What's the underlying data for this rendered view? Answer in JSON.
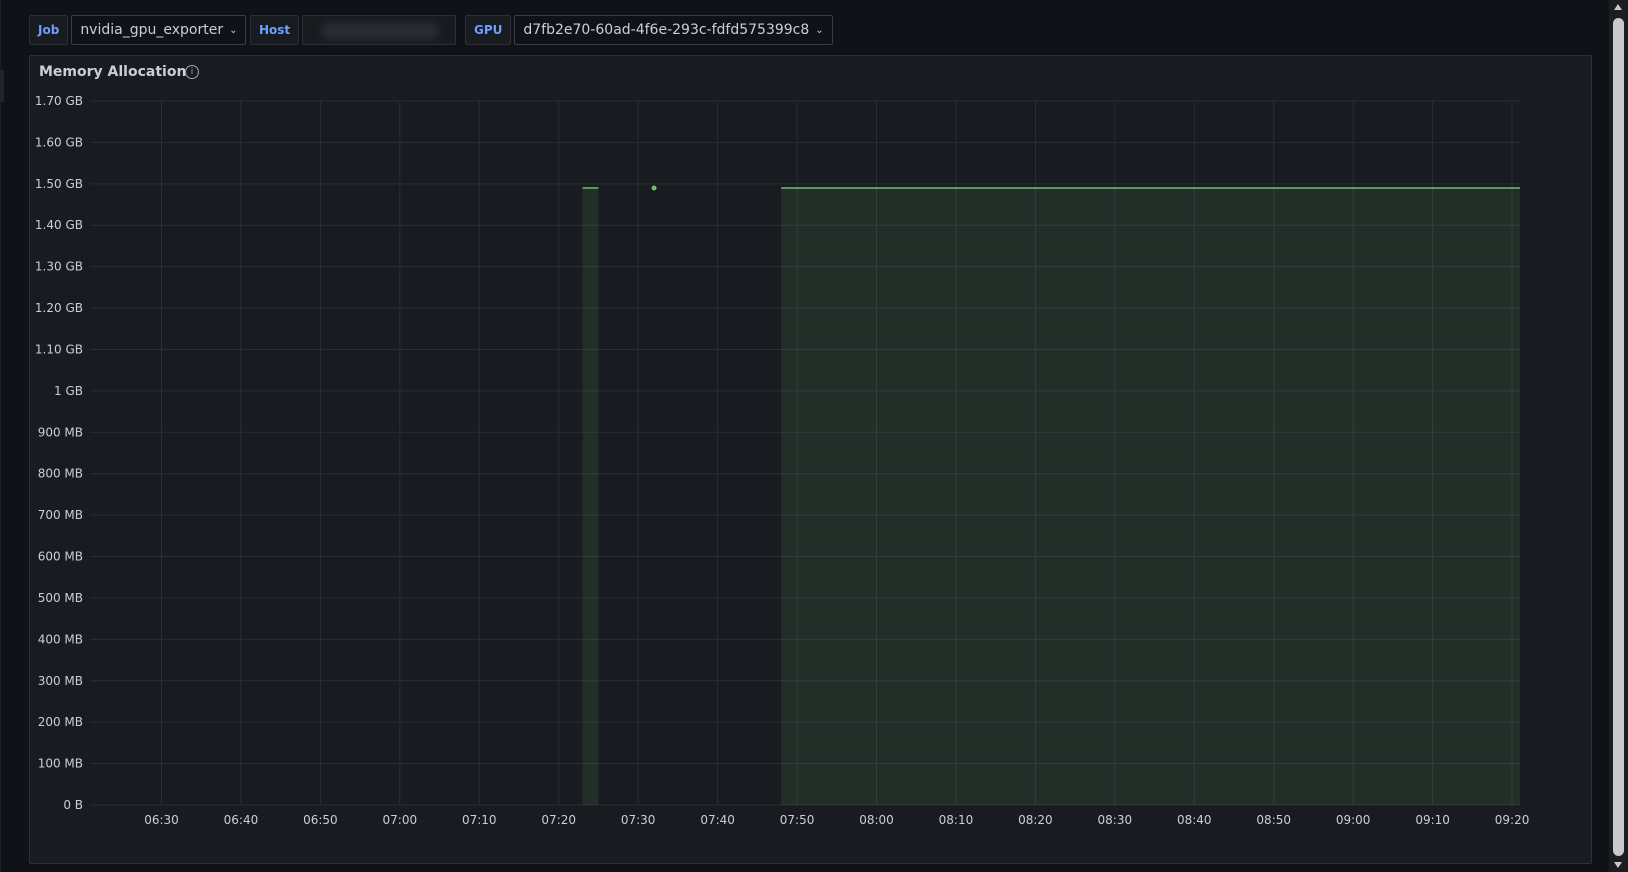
{
  "variables": {
    "job": {
      "label": "Job",
      "value": "nvidia_gpu_exporter"
    },
    "host": {
      "label": "Host",
      "value": ""
    },
    "gpu": {
      "label": "GPU",
      "value": "d7fb2e70-60ad-4f6e-293c-fdfd575399c8"
    }
  },
  "panel": {
    "title": "Memory Allocation",
    "info_icon": "info-icon"
  },
  "colors": {
    "series": "#73bf69",
    "fill": "#73bf69",
    "grid": "#2b2e35",
    "background": "#181b1f"
  },
  "chart_data": {
    "type": "area",
    "ylabel": "",
    "xlabel": "",
    "unit": "bytes (binary GB/MB)",
    "ylim_gb": [
      0,
      1.7
    ],
    "y_ticks": [
      "0 B",
      "100 MB",
      "200 MB",
      "300 MB",
      "400 MB",
      "500 MB",
      "600 MB",
      "700 MB",
      "800 MB",
      "900 MB",
      "1 GB",
      "1.10 GB",
      "1.20 GB",
      "1.30 GB",
      "1.40 GB",
      "1.50 GB",
      "1.60 GB",
      "1.70 GB"
    ],
    "x_ticks": [
      "06:30",
      "06:40",
      "06:50",
      "07:00",
      "07:10",
      "07:20",
      "07:30",
      "07:40",
      "07:50",
      "08:00",
      "08:10",
      "08:20",
      "08:30",
      "08:40",
      "08:50",
      "09:00",
      "09:10",
      "09:20"
    ],
    "xlim": [
      "06:21",
      "09:21"
    ],
    "series": [
      {
        "values": [
          {
            "start": "07:23",
            "end": "07:25",
            "value_gb": 1.49
          },
          {
            "start": "07:32",
            "end": "07:32",
            "value_gb": 1.49
          },
          {
            "start": "07:48",
            "end": "07:49",
            "value_gb": 1.49
          },
          {
            "start": "07:49",
            "end": "09:21",
            "value_gb": 1.49
          }
        ]
      }
    ],
    "grid": true,
    "legend": "none"
  }
}
